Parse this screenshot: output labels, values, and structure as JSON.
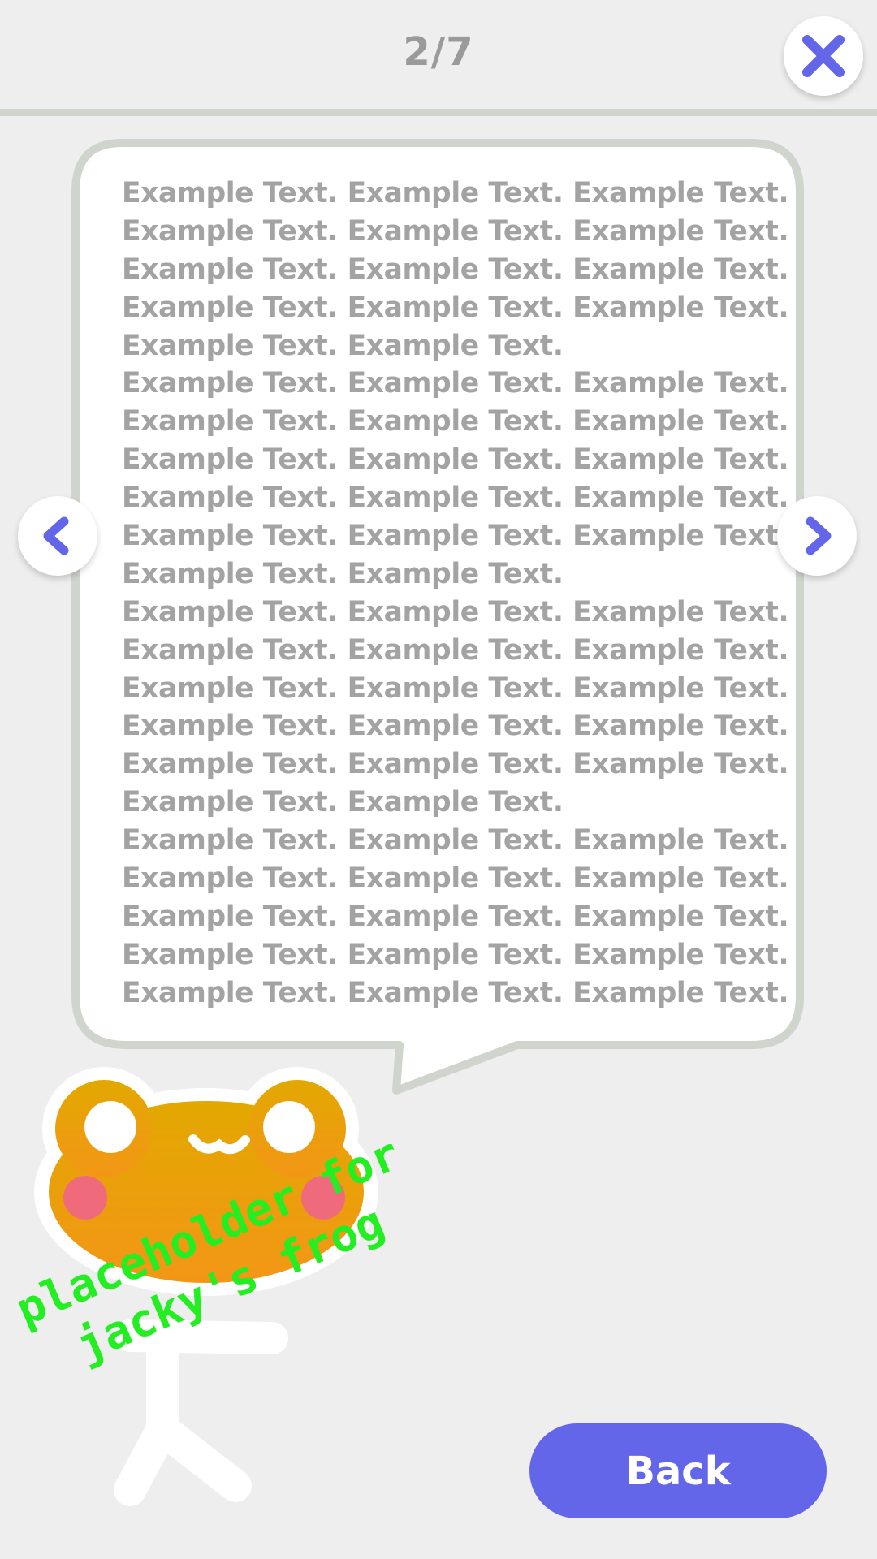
{
  "header": {
    "page_counter": "2/7"
  },
  "icons": {
    "close": "close-icon",
    "prev": "chevron-left-icon",
    "next": "chevron-right-icon"
  },
  "colors": {
    "accent": "#6366e8",
    "background": "#eeeeee",
    "bubble_border": "#cfd4cd",
    "text": "#a3a3a3",
    "frog_top": "#e2a800",
    "frog_bottom": "#f39617",
    "caption": "#22ee22"
  },
  "bubble": {
    "lines": [
      "Example Text. Example Text. Example Text.",
      "Example Text. Example Text. Example Text.",
      "Example Text. Example Text. Example Text.",
      "Example Text. Example Text. Example Text.",
      "Example Text. Example Text.",
      "Example Text. Example Text. Example Text.",
      "Example Text. Example Text. Example Text.",
      "Example Text. Example Text. Example Text.",
      "Example Text. Example Text. Example Text.",
      "Example Text. Example Text. Example Text.",
      "Example Text. Example Text.",
      "Example Text. Example Text. Example Text.",
      "Example Text. Example Text. Example Text.",
      "Example Text. Example Text. Example Text.",
      "Example Text. Example Text. Example Text.",
      "Example Text. Example Text. Example Text.",
      "Example Text. Example Text.",
      "Example Text. Example Text. Example Text.",
      "Example Text. Example Text. Example Text.",
      "Example Text. Example Text. Example Text.",
      "Example Text. Example Text. Example Text.",
      "Example Text. Example Text. Example Text."
    ]
  },
  "frog": {
    "caption_line1": "placeholder for",
    "caption_line2": "jacky's frog"
  },
  "footer": {
    "back_label": "Back"
  }
}
